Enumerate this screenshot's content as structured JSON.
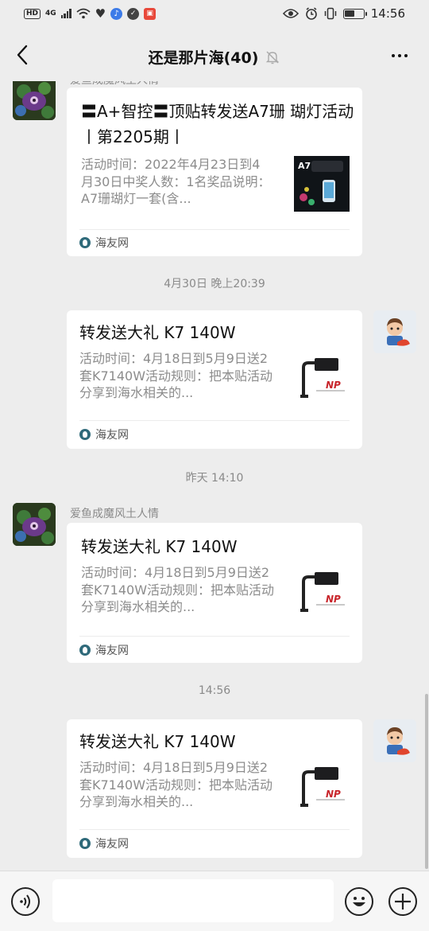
{
  "status_bar": {
    "hd": "HD",
    "network": "4G",
    "time": "14:56",
    "icons": [
      "signal-icon",
      "wifi-icon",
      "heart-icon",
      "music-icon",
      "shield-icon",
      "app-icon",
      "eye-icon",
      "alarm-icon",
      "vibrate-icon",
      "battery-icon"
    ],
    "battery_level": 0.55
  },
  "nav": {
    "back_icon": "chevron-left-icon",
    "title": "还是那片海(40)",
    "mute_icon": "bell-off-icon",
    "more_icon": "more-icon"
  },
  "messages": [
    {
      "side": "left",
      "sender": "爱鱼成魔风土人情",
      "title": "〓A+智控〓顶贴转发送A7珊 瑚灯活动丨第2205期丨",
      "desc": "活动时间：2022年4月23日到4月30日中奖人数：1名奖品说明：A7珊瑚灯一套(含...",
      "thumb_label": "A7",
      "source": "海友网"
    },
    {
      "type": "time",
      "text": "4月30日 晚上20:39"
    },
    {
      "side": "right",
      "title": "转发送大礼 K7 140W",
      "desc": "活动时间：4月18日到5月9日送2套K7140W活动规则：把本贴活动分享到海水相关的...",
      "thumb_label": "NP",
      "source": "海友网"
    },
    {
      "type": "time",
      "text": "昨天 14:10"
    },
    {
      "side": "left",
      "sender": "爱鱼成魔风土人情",
      "title": "转发送大礼 K7 140W",
      "desc": "活动时间：4月18日到5月9日送2套K7140W活动规则：把本贴活动分享到海水相关的...",
      "thumb_label": "NP",
      "source": "海友网"
    },
    {
      "type": "time",
      "text": "14:56"
    },
    {
      "side": "right",
      "title": "转发送大礼 K7 140W",
      "desc": "活动时间：4月18日到5月9日送2套K7140W活动规则：把本贴活动分享到海水相关的...",
      "thumb_label": "NP",
      "source": "海友网"
    }
  ],
  "input_bar": {
    "voice_icon": "voice-icon",
    "emoji_icon": "emoji-icon",
    "plus_icon": "plus-icon",
    "text": ""
  },
  "colors": {
    "background": "#ededed",
    "card": "#ffffff",
    "title_text": "#111111",
    "desc_text": "#8c8c8c",
    "timestamp_text": "#8a8a8a"
  }
}
